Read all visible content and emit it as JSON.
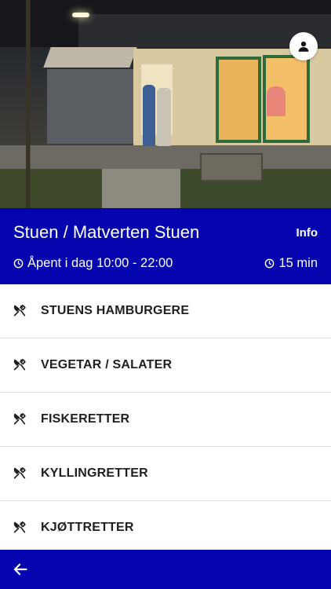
{
  "header": {
    "restaurant_name": "Stuen / Matverten Stuen",
    "info_label": "Info",
    "hours_text": "Åpent i dag 10:00 - 22:00",
    "delivery_time": "15 min"
  },
  "categories": [
    {
      "label": "STUENS HAMBURGERE",
      "icon": "utensils-icon"
    },
    {
      "label": "VEGETAR / SALATER",
      "icon": "utensils-icon"
    },
    {
      "label": "FISKERETTER",
      "icon": "utensils-icon"
    },
    {
      "label": "KYLLINGRETTER",
      "icon": "utensils-icon"
    },
    {
      "label": "KJØTTRETTER",
      "icon": "utensils-icon"
    }
  ],
  "icons": {
    "profile": "person-icon",
    "clock": "clock-icon",
    "back": "arrow-left-icon"
  },
  "colors": {
    "brand_blue": "#0505b0",
    "text_dark": "#1f1f1f",
    "divider": "#dedede"
  }
}
